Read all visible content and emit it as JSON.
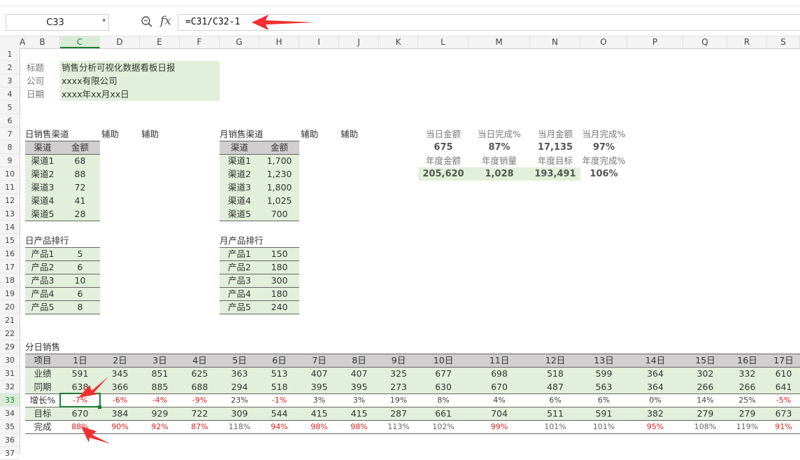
{
  "namebox": {
    "value": "C33"
  },
  "formula_bar": {
    "fx": "fx",
    "value": "=C31/C32-1"
  },
  "columns": [
    "A",
    "B",
    "C",
    "D",
    "E",
    "F",
    "G",
    "H",
    "I",
    "J",
    "K",
    "L",
    "M",
    "N",
    "O",
    "P",
    "Q",
    "R",
    "S"
  ],
  "selected_column": "C",
  "rows": [
    "1",
    "2",
    "3",
    "4",
    "5",
    "6",
    "7",
    "8",
    "9",
    "10",
    "11",
    "12",
    "13",
    "14",
    "15",
    "16",
    "17",
    "18",
    "19",
    "20",
    "21",
    "22",
    "29",
    "30",
    "31",
    "32",
    "33",
    "34",
    "35",
    "36",
    "37"
  ],
  "selected_row": "33",
  "info": {
    "labels": [
      "标题",
      "公司",
      "日期"
    ],
    "values": [
      "销售分析可视化数据看板日报",
      "xxxx有限公司",
      "xxxx年xx月xx日"
    ]
  },
  "daily_channel": {
    "title": "日销售渠道",
    "aux1": "辅助",
    "aux2": "辅助",
    "header": [
      "渠道",
      "金额"
    ],
    "rows": [
      [
        "渠道1",
        "68"
      ],
      [
        "渠道2",
        "88"
      ],
      [
        "渠道3",
        "72"
      ],
      [
        "渠道4",
        "41"
      ],
      [
        "渠道5",
        "28"
      ]
    ]
  },
  "monthly_channel": {
    "title": "月销售渠道",
    "aux1": "辅助",
    "aux2": "辅助",
    "header": [
      "渠道",
      "金额"
    ],
    "rows": [
      [
        "渠道1",
        "1,700"
      ],
      [
        "渠道2",
        "1,230"
      ],
      [
        "渠道3",
        "1,800"
      ],
      [
        "渠道4",
        "1,025"
      ],
      [
        "渠道5",
        "700"
      ]
    ]
  },
  "kpi": {
    "row1_labels": [
      "当日金额",
      "当日完成%",
      "当月金额",
      "当月完成%"
    ],
    "row1_values": [
      "675",
      "87%",
      "17,135",
      "97%"
    ],
    "row2_labels": [
      "年度金额",
      "年度销量",
      "年度目标",
      "年度完成%"
    ],
    "row2_values": [
      "205,620",
      "1,028",
      "193,491",
      "106%"
    ]
  },
  "daily_product": {
    "title": "日产品排行",
    "rows": [
      [
        "产品1",
        "5"
      ],
      [
        "产品2",
        "6"
      ],
      [
        "产品3",
        "10"
      ],
      [
        "产品4",
        "6"
      ],
      [
        "产品5",
        "8"
      ]
    ]
  },
  "monthly_product": {
    "title": "月产品排行",
    "rows": [
      [
        "产品1",
        "150"
      ],
      [
        "产品2",
        "180"
      ],
      [
        "产品3",
        "300"
      ],
      [
        "产品4",
        "180"
      ],
      [
        "产品5",
        "240"
      ]
    ]
  },
  "daily_sales": {
    "title": "分日销售",
    "row_labels": [
      "项目",
      "业绩",
      "同期",
      "增长%",
      "目标",
      "完成"
    ],
    "days": [
      "1日",
      "2日",
      "3日",
      "4日",
      "5日",
      "6日",
      "7日",
      "8日",
      "9日",
      "10日",
      "11日",
      "12日",
      "13日",
      "14日",
      "15日",
      "16日",
      "17日"
    ],
    "sales": [
      "591",
      "345",
      "851",
      "625",
      "363",
      "513",
      "407",
      "407",
      "325",
      "677",
      "698",
      "518",
      "599",
      "364",
      "302",
      "332",
      "610"
    ],
    "prior": [
      "638",
      "366",
      "885",
      "688",
      "294",
      "518",
      "395",
      "395",
      "273",
      "630",
      "670",
      "487",
      "563",
      "364",
      "266",
      "266",
      "641"
    ],
    "growth": [
      "-7%",
      "-6%",
      "-4%",
      "-9%",
      "23%",
      "-1%",
      "3%",
      "3%",
      "19%",
      "8%",
      "4%",
      "6%",
      "6%",
      "0%",
      "14%",
      "25%",
      "-5%"
    ],
    "target": [
      "670",
      "384",
      "929",
      "722",
      "309",
      "544",
      "415",
      "415",
      "287",
      "661",
      "704",
      "511",
      "591",
      "382",
      "279",
      "279",
      "673"
    ],
    "completion": [
      "88%",
      "90%",
      "92%",
      "87%",
      "118%",
      "94%",
      "98%",
      "98%",
      "113%",
      "102%",
      "99%",
      "101%",
      "101%",
      "95%",
      "108%",
      "119%",
      "91%"
    ]
  },
  "colors": {
    "green_fill": "#e2efda",
    "gray_header": "#d0cece",
    "negative": "#e02020",
    "select": "#1e7b34",
    "arrow": "#f03030"
  }
}
